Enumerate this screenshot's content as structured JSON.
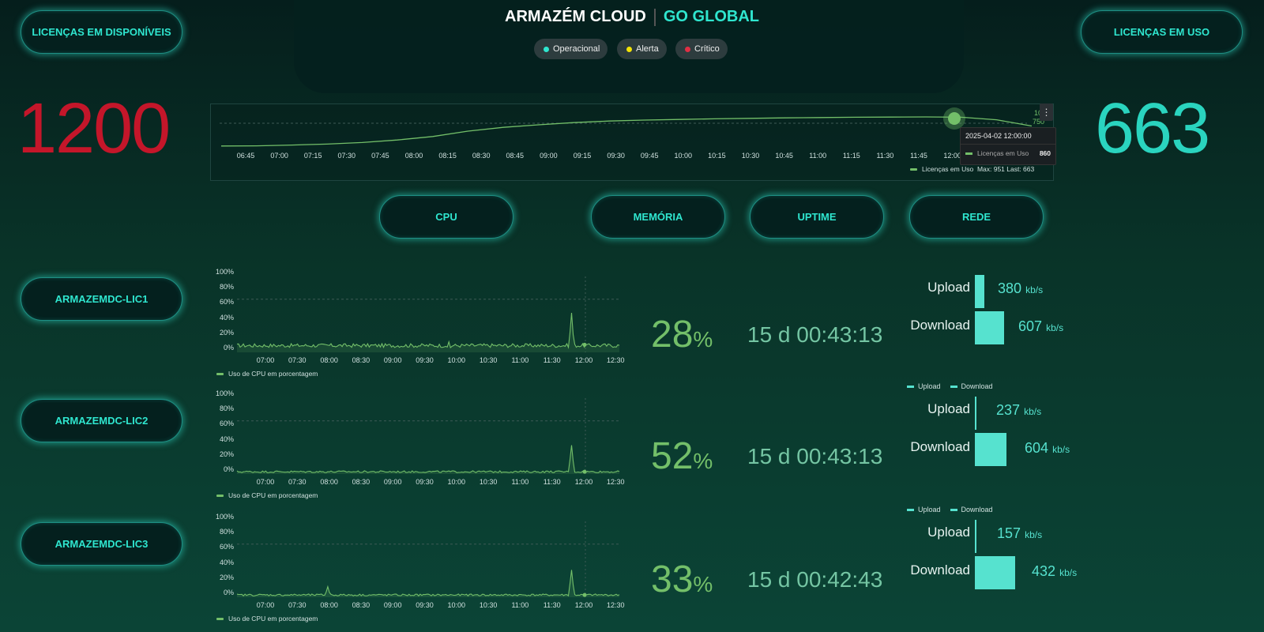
{
  "header": {
    "brand_main": "ARMAZÉM CLOUD",
    "brand_accent": "GO GLOBAL",
    "status": [
      {
        "label": "Operacional",
        "color": "#2fe6cf"
      },
      {
        "label": "Alerta",
        "color": "#f2e205"
      },
      {
        "label": "Crítico",
        "color": "#e02f44"
      }
    ]
  },
  "licenses": {
    "available_label": "LICENÇAS EM DISPONÍVEIS",
    "available_value": "1200",
    "in_use_label": "LICENÇAS EM USO",
    "in_use_value": "663"
  },
  "tabs": [
    {
      "label": "CPU"
    },
    {
      "label": "MEMÓRIA"
    },
    {
      "label": "UPTIME"
    },
    {
      "label": "REDE"
    }
  ],
  "license_chart": {
    "x_ticks": [
      "06:45",
      "07:00",
      "07:15",
      "07:30",
      "07:45",
      "08:00",
      "08:15",
      "08:30",
      "08:45",
      "09:00",
      "09:15",
      "09:30",
      "09:45",
      "10:00",
      "10:15",
      "10:30",
      "10:45",
      "11:00",
      "11:15",
      "11:30",
      "11:45",
      "12:00"
    ],
    "y_ticks_visible": [
      "10(",
      "750"
    ],
    "legend": "Licenças em Uso",
    "legend_stats": "Max: 951  Last: 663",
    "tooltip_time": "2025-04-02 12:00:00",
    "tooltip_series": "Licenças em Uso",
    "tooltip_value": "860",
    "menu_glyph": "⋮"
  },
  "cpu_chart": {
    "y_ticks": [
      "100%",
      "80%",
      "60%",
      "40%",
      "20%",
      "0%"
    ],
    "x_ticks": [
      "07:00",
      "07:30",
      "08:00",
      "08:30",
      "09:00",
      "09:30",
      "10:00",
      "10:30",
      "11:00",
      "11:30",
      "12:00",
      "12:30"
    ],
    "legend": "Uso de CPU em porcentagem"
  },
  "net_labels": {
    "upload": "Upload",
    "download": "Download",
    "unit": "kb/s"
  },
  "servers": [
    {
      "name": "ARMAZEMDC-LIC1",
      "cpu": "28",
      "pct_sign": "%",
      "uptime": "15 d 00:43:13",
      "upload": "380",
      "download": "607"
    },
    {
      "name": "ARMAZEMDC-LIC2",
      "cpu": "52",
      "pct_sign": "%",
      "uptime": "15 d 00:43:13",
      "upload": "237",
      "download": "604"
    },
    {
      "name": "ARMAZEMDC-LIC3",
      "cpu": "33",
      "pct_sign": "%",
      "uptime": "15 d 00:42:43",
      "upload": "157",
      "download": "432"
    }
  ],
  "chart_data": [
    {
      "type": "line",
      "legend": "Licenças em Uso",
      "x": [
        "06:40",
        "06:45",
        "07:00",
        "07:15",
        "07:30",
        "07:45",
        "08:00",
        "08:15",
        "08:30",
        "08:45",
        "09:00",
        "09:15",
        "09:30",
        "09:45",
        "10:00",
        "10:15",
        "10:30",
        "10:45",
        "11:00",
        "11:15",
        "11:30",
        "11:45",
        "12:00",
        "12:10"
      ],
      "series": [
        {
          "name": "Licenças em Uso",
          "values": [
            30,
            35,
            60,
            90,
            140,
            220,
            330,
            500,
            620,
            700,
            770,
            820,
            850,
            870,
            890,
            905,
            920,
            930,
            940,
            945,
            951,
            940,
            860,
            663
          ]
        }
      ],
      "ylim": [
        0,
        1000
      ]
    },
    {
      "type": "line",
      "legend": "Uso de CPU em porcentagem",
      "x": [
        "07:00",
        "07:30",
        "08:00",
        "08:30",
        "09:00",
        "09:30",
        "10:00",
        "10:30",
        "11:00",
        "11:30",
        "12:00",
        "12:15",
        "12:30"
      ],
      "series": [
        {
          "name": "Uso de CPU em porcentagem",
          "values": [
            8,
            9,
            8,
            10,
            9,
            10,
            9,
            14,
            9,
            9,
            10,
            52,
            9
          ]
        }
      ],
      "ylim": [
        0,
        100
      ]
    },
    {
      "type": "line",
      "legend": "Uso de CPU em porcentagem",
      "x": [
        "07:00",
        "07:30",
        "08:00",
        "08:30",
        "09:00",
        "09:30",
        "10:00",
        "10:30",
        "11:00",
        "11:30",
        "12:00",
        "12:15",
        "12:30"
      ],
      "series": [
        {
          "name": "Uso de CPU em porcentagem",
          "values": [
            3,
            3,
            4,
            3,
            3,
            3,
            5,
            3,
            3,
            3,
            3,
            38,
            3
          ]
        }
      ],
      "ylim": [
        0,
        100
      ]
    },
    {
      "type": "line",
      "legend": "Uso de CPU em porcentagem",
      "x": [
        "07:00",
        "07:30",
        "08:00",
        "08:30",
        "09:00",
        "09:30",
        "10:00",
        "10:30",
        "11:00",
        "11:30",
        "12:00",
        "12:15",
        "12:30"
      ],
      "series": [
        {
          "name": "Uso de CPU em porcentagem",
          "values": [
            3,
            3,
            4,
            14,
            3,
            3,
            3,
            3,
            3,
            3,
            3,
            36,
            3
          ]
        }
      ],
      "ylim": [
        0,
        100
      ]
    }
  ]
}
